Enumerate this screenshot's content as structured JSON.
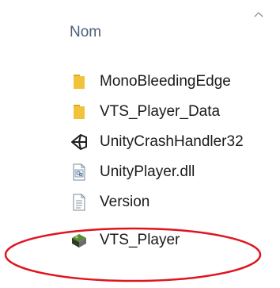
{
  "header": {
    "column_label": "Nom",
    "sort_icon": "chevron-up-icon"
  },
  "files": [
    {
      "name": "MonoBleedingEdge",
      "icon": "folder-icon"
    },
    {
      "name": "VTS_Player_Data",
      "icon": "folder-icon"
    },
    {
      "name": "UnityCrashHandler32",
      "icon": "unity-logo-icon"
    },
    {
      "name": "UnityPlayer.dll",
      "icon": "dll-file-icon"
    },
    {
      "name": "Version",
      "icon": "text-file-icon"
    },
    {
      "name": "VTS_Player",
      "icon": "application-icon"
    }
  ],
  "annotation": {
    "type": "ellipse",
    "color": "#e0141e",
    "target": "VTS_Player"
  },
  "colors": {
    "header_text": "#4c607a",
    "folder": "#f2c33a",
    "highlight": "#e0141e"
  }
}
